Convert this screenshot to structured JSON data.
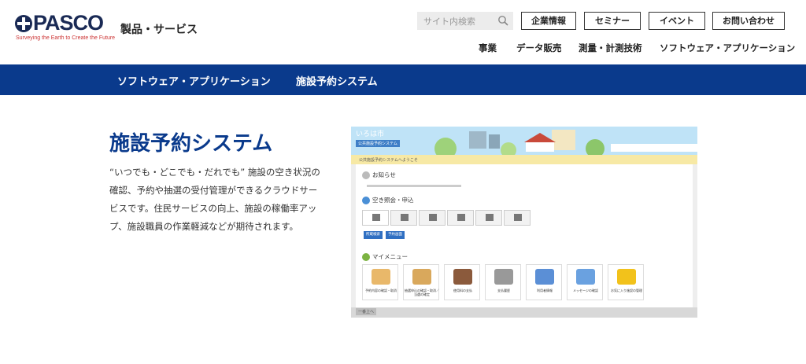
{
  "logo": {
    "text": "PASCO",
    "tagline": "Surveying the Earth to Create the Future"
  },
  "header": {
    "products_label": "製品・サービス",
    "search_placeholder": "サイト内検索",
    "top_buttons": [
      "企業情報",
      "セミナー",
      "イベント",
      "お問い合わせ"
    ],
    "nav": [
      "事業",
      "データ販売",
      "測量・計測技術",
      "ソフトウェア・アプリケーション"
    ]
  },
  "breadcrumb": [
    "ソフトウェア・アプリケーション",
    "施設予約システム"
  ],
  "main": {
    "title": "施設予約システム",
    "description": "“いつでも・どこでも・だれでも” 施設の空き状況の確認、予約や抽選の受付管理ができるクラウドサービスです。住民サービスの向上、施設の稼働率アップ、施設職員の作業軽減などが期待されます。"
  },
  "screenshot": {
    "city": "いろは市",
    "badge": "公共施設予約システム",
    "welcome": "公共施設予約システムへようこそ",
    "news_label": "お知らせ",
    "search_label": "空き照会・申込",
    "menu_label": "マイメニュー",
    "blue_buttons": [
      "所蔵検索",
      "予約画面"
    ],
    "cards": [
      {
        "label": "予約内容の確認・取消",
        "color": "#e9b86a"
      },
      {
        "label": "抽選申込の確認・取消／当選の確定",
        "color": "#d9a85c"
      },
      {
        "label": "使用料の支払",
        "color": "#8b5a3c"
      },
      {
        "label": "支払履歴",
        "color": "#999999"
      },
      {
        "label": "利用者情報",
        "color": "#5b8fd6"
      },
      {
        "label": "メッセージの確認",
        "color": "#6aa1e0"
      },
      {
        "label": "お気に入り施設の管理",
        "color": "#f2c21b"
      }
    ],
    "footer_button": "一番上へ"
  },
  "colors": {
    "brand_blue": "#0a3a8c",
    "logo_navy": "#1a2a55",
    "logo_red": "#c33333"
  }
}
